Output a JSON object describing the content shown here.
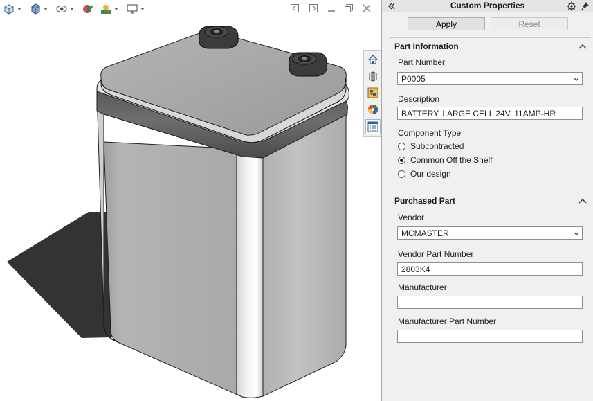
{
  "panel": {
    "title": "Custom Properties",
    "apply_label": "Apply",
    "reset_label": "Reset"
  },
  "part_info": {
    "heading": "Part Information",
    "part_number": {
      "label": "Part Number",
      "value": "P0005"
    },
    "description": {
      "label": "Description",
      "value": "BATTERY, LARGE CELL 24V, 11AMP-HR"
    },
    "component_type": {
      "label": "Component Type",
      "options": [
        "Subcontracted",
        "Common Off the Shelf",
        "Our design"
      ],
      "selected": "Common Off the Shelf"
    }
  },
  "purchased": {
    "heading": "Purchased Part",
    "vendor": {
      "label": "Vendor",
      "value": "MCMASTER"
    },
    "vendor_part_number": {
      "label": "Vendor Part Number",
      "value": "2803K4"
    },
    "manufacturer": {
      "label": "Manufacturer",
      "value": ""
    },
    "manufacturer_part_number": {
      "label": "Manufacturer Part Number",
      "value": ""
    }
  },
  "icons": {
    "view_toolbar": [
      "view-orientation-icon",
      "display-style-icon",
      "hide-show-items-icon",
      "edit-appearance-icon",
      "apply-scene-icon",
      "view-settings-icon"
    ],
    "window_controls": [
      "tile-left-icon",
      "tile-right-icon",
      "minimize-icon",
      "restore-icon",
      "close-icon"
    ],
    "task_pane_tabs": [
      "home-tab-icon",
      "design-library-icon",
      "file-explorer-icon",
      "appearances-icon",
      "custom-properties-icon"
    ]
  },
  "colors": {
    "panel_background": "#f0f0f0",
    "active_tab_border": "#9bb7d6"
  }
}
